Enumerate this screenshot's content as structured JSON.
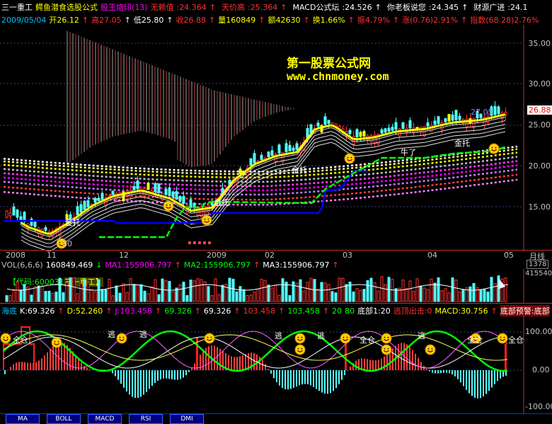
{
  "main_header": {
    "stock": "三一重工",
    "formula": "鳄鱼潜食选股公式",
    "signal": "股王烙印(13)",
    "items": [
      {
        "label": "无赖值",
        "value": "24.364",
        "arrow": "↑",
        "color": "#ff3030"
      },
      {
        "label": "天价高",
        "value": "25.364",
        "arrow": "↑",
        "color": "#ff3030"
      },
      {
        "label": "MACD公式坛",
        "value": "24.526",
        "arrow": "↑",
        "color": "#ffffff"
      },
      {
        "label": "你老板说您",
        "value": "24.345",
        "arrow": "↑",
        "color": "#ffffff"
      },
      {
        "label": "财源广进",
        "value": "24.1",
        "arrow": "",
        "color": "#ffffff"
      }
    ]
  },
  "quote_line": {
    "date": "2009/05/04",
    "open": "开26.12",
    "high": "高27.05",
    "low": "低25.80",
    "close": "收26.88",
    "volume": "量160849",
    "amount": "额42630",
    "turnover": "换1.66%",
    "amplitude": "振4.79%",
    "change": "涨(0.76)2.91%",
    "index": "指数(68.28)2.76%"
  },
  "watermark": {
    "title": "第一股票公式网",
    "url": "www.chnmoney.com"
  },
  "price_axis": {
    "ticks": [
      "35.00",
      "30.00",
      "25.00",
      "20.00",
      "15.00"
    ],
    "current": "26.88",
    "high_mark": "27.05"
  },
  "chart_labels": {
    "low_mark": "80",
    "niu1": "牛了",
    "tuo1": "金托",
    "tuo2": "金托",
    "tuo3": "金托",
    "tuo4": "金托"
  },
  "time_axis": {
    "labels": [
      "2008",
      "11",
      "12",
      "2009",
      "02",
      "03",
      "04",
      "05"
    ],
    "unit": "月线"
  },
  "vol_header": {
    "title": "VOL(6,6,6)",
    "vol": "160849.469",
    "ma1": "MA1:155906.797",
    "ma2": "MA2:155906.797",
    "ma3": "MA3:155906.797",
    "right_top": "1378",
    "right_bottom": "415540"
  },
  "vol_overlay": {
    "code": "【代码:600031",
    "name": "三一重工】"
  },
  "ind_header": {
    "title": "海底",
    "k": "K:69.326",
    "d": "D:52.260",
    "j": "J:103.458",
    "v1": "69.326",
    "v2": "69.326",
    "v3": "103.458",
    "v4": "103.458",
    "v5": "20",
    "v6": "80",
    "bottom": "底部1:20",
    "escape": "逃顶出击:0",
    "macd": "MACD:30.756",
    "warn": "底部预警:底部"
  },
  "ind_axis": {
    "ticks": [
      "100.00",
      "0.00"
    ]
  },
  "ind_labels": {
    "escape": "逃",
    "fullpos": "全仓"
  },
  "tabs": [
    "MA",
    "BOLL",
    "MACD",
    "RSI",
    "DMI"
  ],
  "colors": {
    "up": "#ff3232",
    "down": "#54ffff",
    "yellow": "#ffff00",
    "green": "#00ff00",
    "blue": "#0000ff",
    "magenta": "#ff00ff"
  }
}
